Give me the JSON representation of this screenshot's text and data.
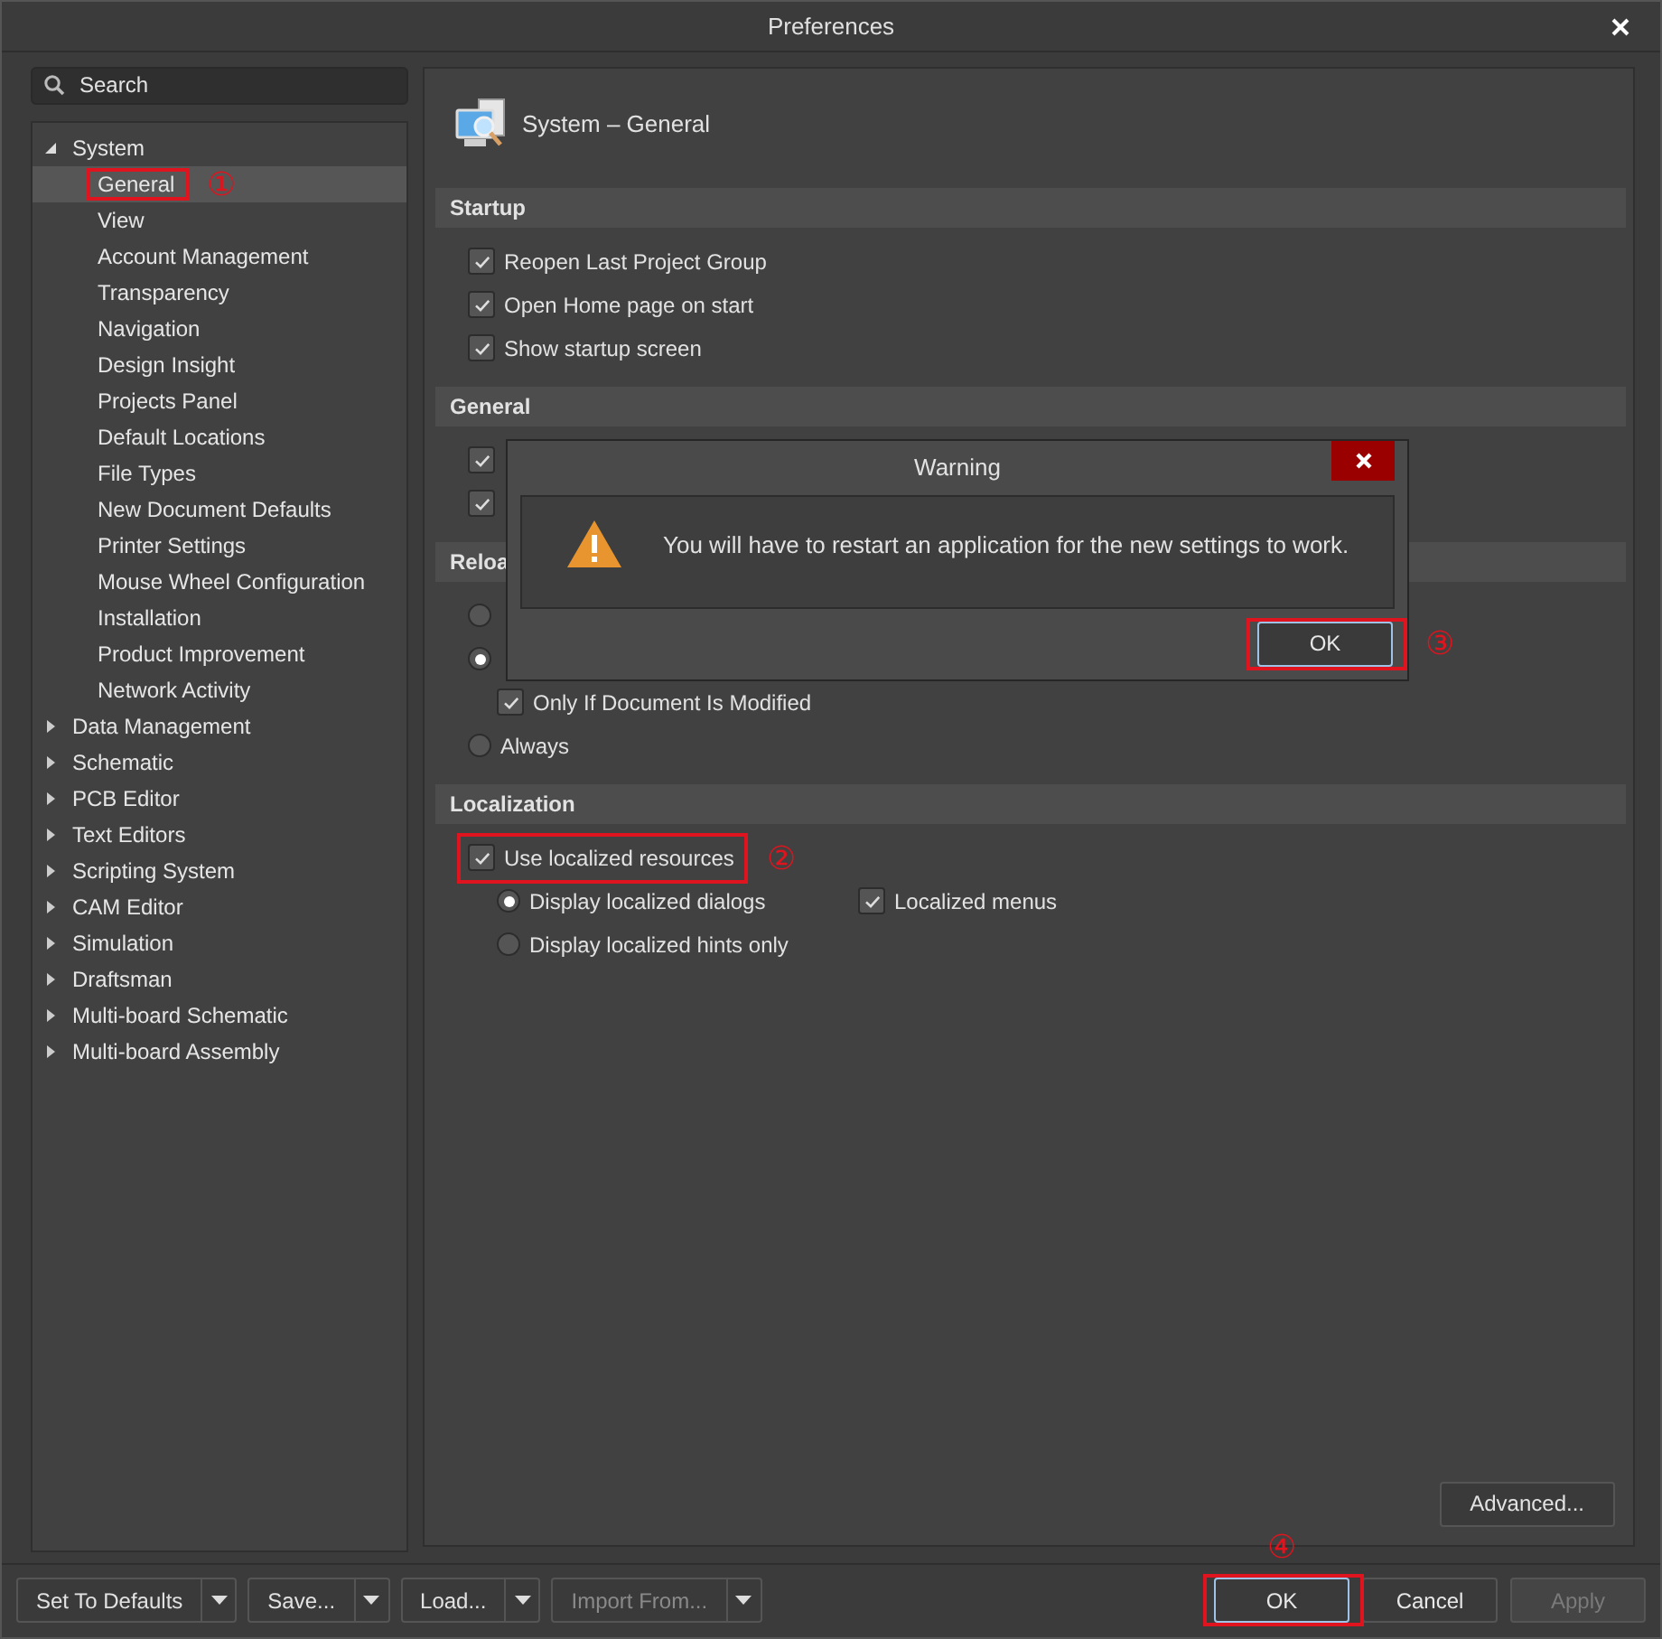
{
  "window": {
    "title": "Preferences"
  },
  "search": {
    "placeholder": "Search"
  },
  "tree": [
    {
      "label": "System",
      "expanded": true,
      "selected": false,
      "children": [
        {
          "label": "General",
          "selected": true,
          "annotation": "①"
        },
        {
          "label": "View",
          "selected": false
        },
        {
          "label": "Account Management",
          "selected": false
        },
        {
          "label": "Transparency",
          "selected": false
        },
        {
          "label": "Navigation",
          "selected": false
        },
        {
          "label": "Design Insight",
          "selected": false
        },
        {
          "label": "Projects Panel",
          "selected": false
        },
        {
          "label": "Default Locations",
          "selected": false
        },
        {
          "label": "File Types",
          "selected": false
        },
        {
          "label": "New Document Defaults",
          "selected": false
        },
        {
          "label": "Printer Settings",
          "selected": false
        },
        {
          "label": "Mouse Wheel Configuration",
          "selected": false
        },
        {
          "label": "Installation",
          "selected": false
        },
        {
          "label": "Product Improvement",
          "selected": false
        },
        {
          "label": "Network Activity",
          "selected": false
        }
      ]
    },
    {
      "label": "Data Management",
      "expanded": false,
      "selected": false
    },
    {
      "label": "Schematic",
      "expanded": false,
      "selected": false
    },
    {
      "label": "PCB Editor",
      "expanded": false,
      "selected": false
    },
    {
      "label": "Text Editors",
      "expanded": false,
      "selected": false
    },
    {
      "label": "Scripting System",
      "expanded": false,
      "selected": false
    },
    {
      "label": "CAM Editor",
      "expanded": false,
      "selected": false
    },
    {
      "label": "Simulation",
      "expanded": false,
      "selected": false
    },
    {
      "label": "Draftsman",
      "expanded": false,
      "selected": false
    },
    {
      "label": "Multi-board Schematic",
      "expanded": false,
      "selected": false
    },
    {
      "label": "Multi-board Assembly",
      "expanded": false,
      "selected": false
    }
  ],
  "page": {
    "title": "System – General",
    "sections": [
      {
        "title": "Startup",
        "items": [
          {
            "kind": "checkbox",
            "label": "Reopen Last Project Group",
            "checked": true
          },
          {
            "kind": "checkbox",
            "label": "Open Home page on start",
            "checked": true
          },
          {
            "kind": "checkbox",
            "label": "Show startup screen",
            "checked": true
          }
        ]
      },
      {
        "title": "General",
        "items": [
          {
            "kind": "checkbox",
            "checked": true
          },
          {
            "kind": "checkbox",
            "checked": true
          }
        ]
      },
      {
        "title": "Reloa",
        "items": [
          {
            "kind": "radio",
            "selected": false
          },
          {
            "kind": "radio",
            "selected": true,
            "children": [
              {
                "kind": "checkbox",
                "label": "Only If Document Is Modified",
                "checked": true
              }
            ]
          },
          {
            "kind": "radio",
            "label": "Always",
            "selected": false
          }
        ]
      },
      {
        "title": "Localization",
        "items": [
          {
            "kind": "checkbox",
            "label": "Use localized resources",
            "checked": true,
            "annotation": "②",
            "children": [
              {
                "kind": "radio",
                "label": "Display localized dialogs",
                "selected": true
              },
              {
                "kind": "checkbox",
                "label": "Localized menus",
                "checked": true
              },
              {
                "kind": "radio",
                "label": "Display localized hints only",
                "selected": false
              }
            ]
          }
        ]
      }
    ],
    "advanced_button": "Advanced..."
  },
  "dialog": {
    "title": "Warning",
    "message": "You will have to restart an application for the new settings to work.",
    "button": {
      "label": "OK",
      "annotation": "③"
    }
  },
  "footer": {
    "left": [
      {
        "label": "Set To Defaults",
        "disabled": false
      },
      {
        "label": "Save...",
        "disabled": false
      },
      {
        "label": "Load...",
        "disabled": false
      },
      {
        "label": "Import From...",
        "disabled": true
      }
    ],
    "right": [
      {
        "label": "OK",
        "disabled": false,
        "focused": true,
        "annotation": "④"
      },
      {
        "label": "Cancel",
        "disabled": false,
        "focused": false
      },
      {
        "label": "Apply",
        "disabled": true,
        "focused": false
      }
    ]
  }
}
